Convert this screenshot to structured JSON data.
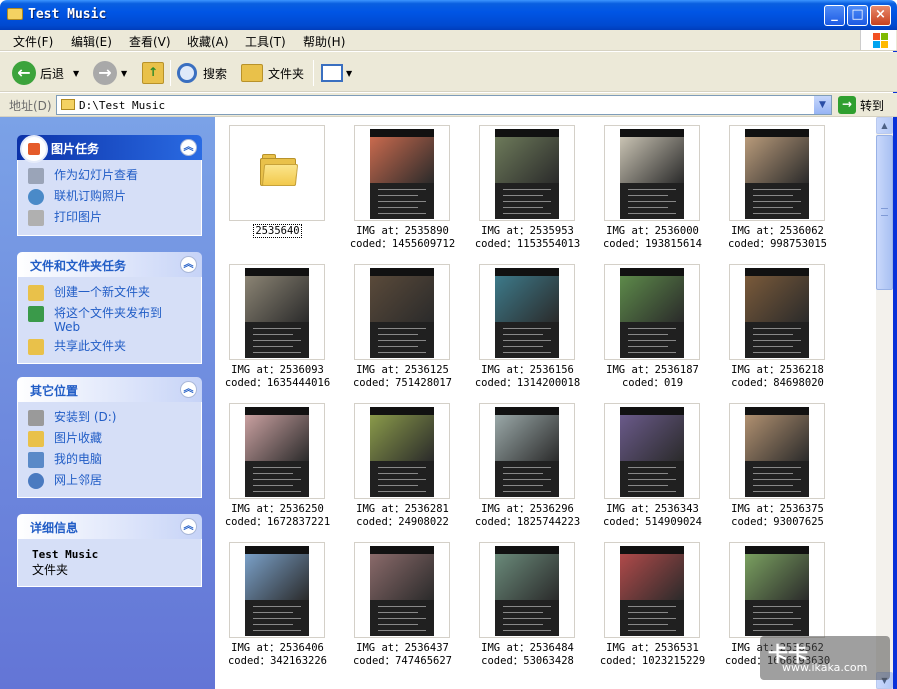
{
  "window": {
    "title": "Test Music",
    "min_label": "_",
    "max_label": "□",
    "close_label": "×"
  },
  "menu": {
    "file": "文件(F)",
    "edit": "编辑(E)",
    "view": "查看(V)",
    "favorites": "收藏(A)",
    "tools": "工具(T)",
    "help": "帮助(H)"
  },
  "toolbar": {
    "back": "后退",
    "search": "搜索",
    "folders": "文件夹"
  },
  "address": {
    "label": "地址(D)",
    "path": "D:\\Test Music",
    "go": "转到"
  },
  "taskpane": {
    "picture_tasks": {
      "title": "图片任务",
      "items": [
        "作为幻灯片查看",
        "联机订购照片",
        "打印图片"
      ]
    },
    "file_tasks": {
      "title": "文件和文件夹任务",
      "items": [
        "创建一个新文件夹",
        "将这个文件夹发布到 Web",
        "共享此文件夹"
      ]
    },
    "other_places": {
      "title": "其它位置",
      "items": [
        "安装到 (D:)",
        "图片收藏",
        "我的电脑",
        "网上邻居"
      ]
    },
    "details": {
      "title": "详细信息",
      "name": "Test Music",
      "type": "文件夹"
    }
  },
  "files": {
    "folder": {
      "label": "2535640"
    },
    "images": [
      {
        "l1": "IMG at：2535890",
        "l2": "coded：1455609712",
        "color": "#c96a4e"
      },
      {
        "l1": "IMG at：2535953",
        "l2": "coded：1153554013",
        "color": "#6d7a5a"
      },
      {
        "l1": "IMG at：2536000",
        "l2": "coded：193815614",
        "color": "#c9c3b3"
      },
      {
        "l1": "IMG at：2536062",
        "l2": "coded：998753015",
        "color": "#b89a7a"
      },
      {
        "l1": "IMG at：2536093",
        "l2": "coded：1635444016",
        "color": "#8b8474"
      },
      {
        "l1": "IMG at：2536125",
        "l2": "coded：751428017",
        "color": "#5a4a3a"
      },
      {
        "l1": "IMG at：2536156",
        "l2": "coded：1314200018",
        "color": "#3d7a8a"
      },
      {
        "l1": "IMG at：2536187",
        "l2": "coded：019",
        "color": "#5d8a4a"
      },
      {
        "l1": "IMG at：2536218",
        "l2": "coded：84698020",
        "color": "#7a5a3a"
      },
      {
        "l1": "IMG at：2536250",
        "l2": "coded：1672837221",
        "color": "#c9a0a0"
      },
      {
        "l1": "IMG at：2536281",
        "l2": "coded：24908022",
        "color": "#8a9a4a"
      },
      {
        "l1": "IMG at：2536296",
        "l2": "coded：1825744223",
        "color": "#9aa8a8"
      },
      {
        "l1": "IMG at：2536343",
        "l2": "coded：514909024",
        "color": "#6a5a8a"
      },
      {
        "l1": "IMG at：2536375",
        "l2": "coded：93007625",
        "color": "#b09070"
      },
      {
        "l1": "IMG at：2536406",
        "l2": "coded：342163226",
        "color": "#7aa0c8"
      },
      {
        "l1": "IMG at：2536437",
        "l2": "coded：747465627",
        "color": "#8a6a6a"
      },
      {
        "l1": "IMG at：2536484",
        "l2": "coded：53063428",
        "color": "#6a8a7a"
      },
      {
        "l1": "IMG at：2536531",
        "l2": "coded：1023215229",
        "color": "#b04a4a"
      },
      {
        "l1": "IMG at：2536562",
        "l2": "coded：1666893630",
        "color": "#7aa060"
      }
    ]
  },
  "watermark": {
    "logo": "卡卡",
    "url": "www.ikaka.com"
  }
}
